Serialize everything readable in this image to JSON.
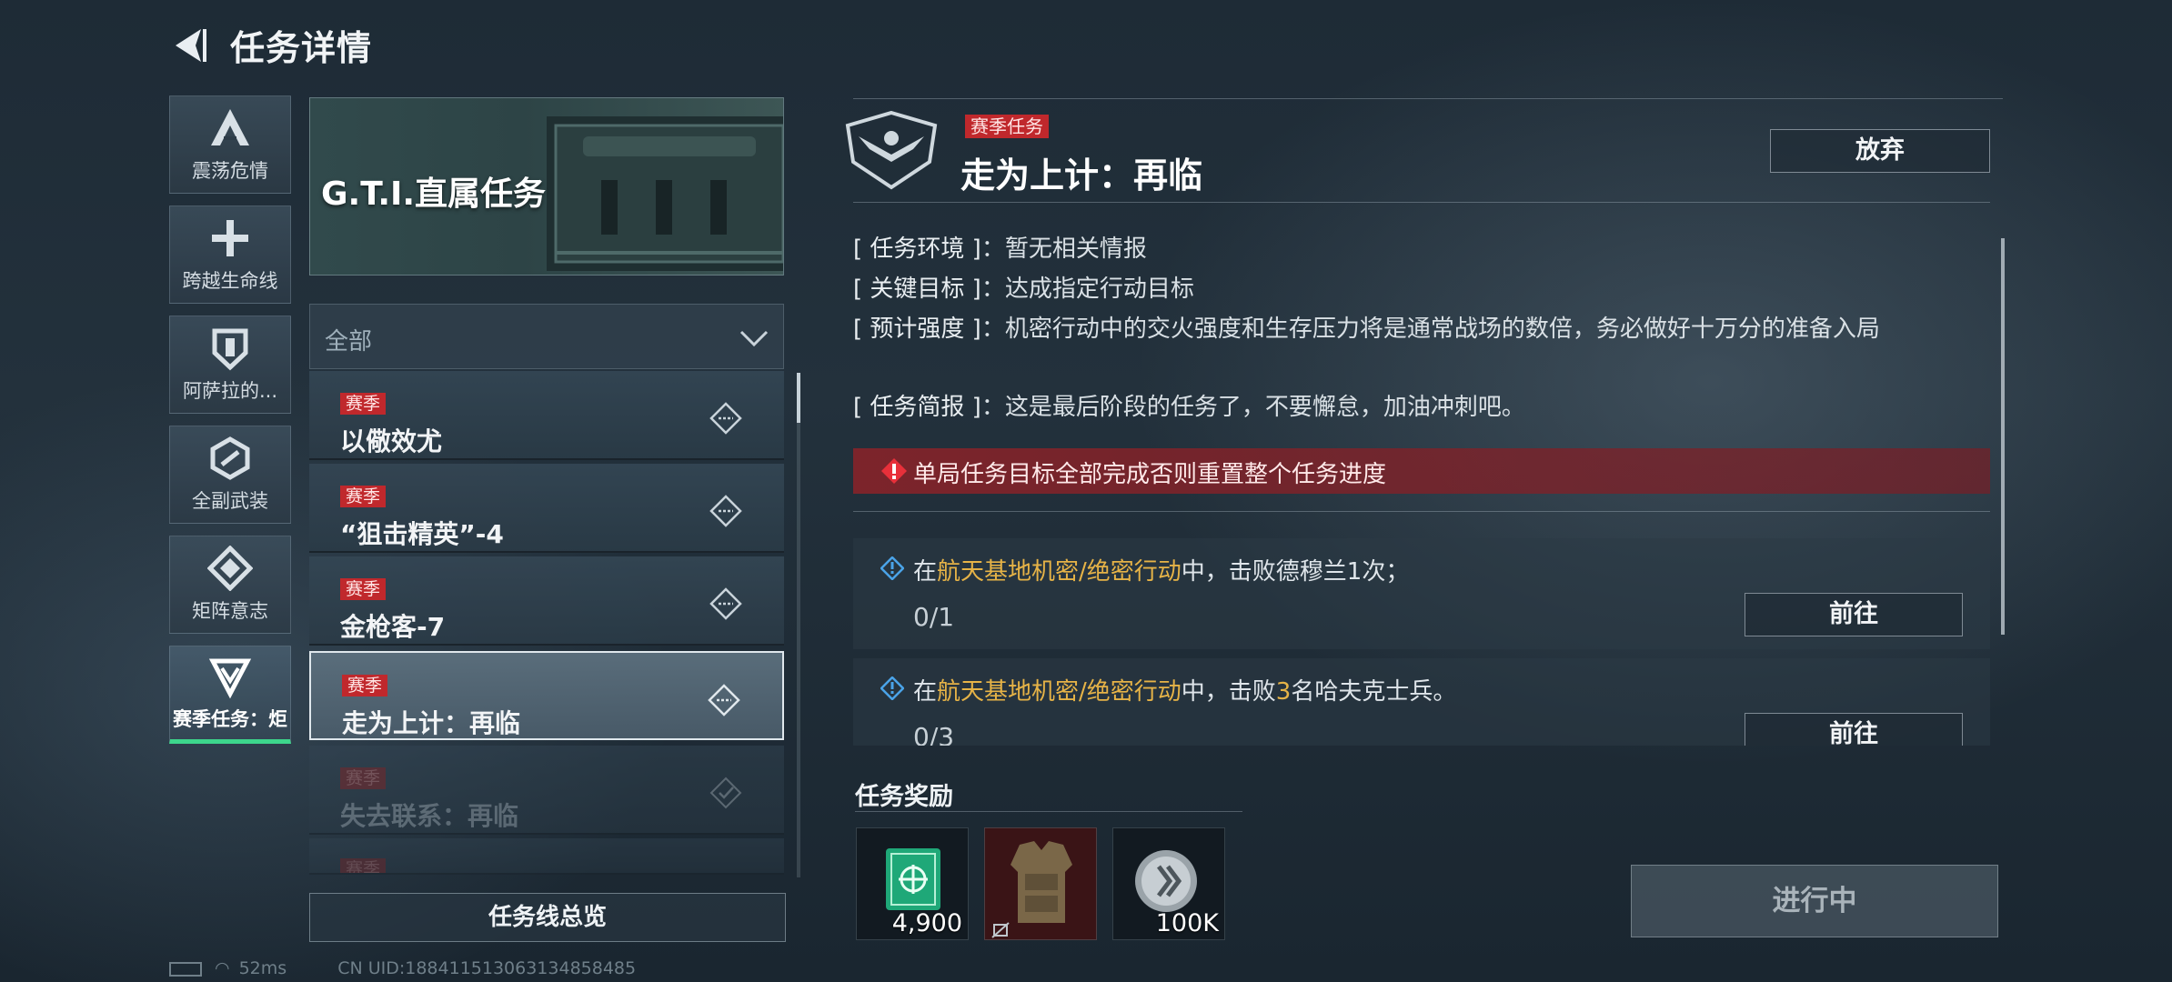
{
  "header": {
    "title": "任务详情"
  },
  "categories": [
    {
      "label": "震荡危情",
      "icon": "triangle-a-icon"
    },
    {
      "label": "跨越生命线",
      "icon": "cross-icon"
    },
    {
      "label": "阿萨拉的...",
      "icon": "shield-icon"
    },
    {
      "label": "全副武装",
      "icon": "hex-chain-icon"
    },
    {
      "label": "矩阵意志",
      "icon": "diamond-icon"
    },
    {
      "label": "赛季任务：炬",
      "icon": "chevron-triangle-icon",
      "active": true
    }
  ],
  "banner": {
    "title": "G.T.I.直属任务"
  },
  "filter": {
    "value": "全部"
  },
  "missions": [
    {
      "tag": "赛季",
      "name": "以儆效尤",
      "status": "in-progress"
    },
    {
      "tag": "赛季",
      "name": "“狙击精英”-4",
      "status": "in-progress"
    },
    {
      "tag": "赛季",
      "name": "金枪客-7",
      "status": "in-progress"
    },
    {
      "tag": "赛季",
      "name": "走为上计：再临",
      "status": "in-progress",
      "selected": true
    },
    {
      "tag": "赛季",
      "name": "失去联系：再临",
      "status": "done"
    },
    {
      "tag": "赛季",
      "name": "",
      "status": "done"
    }
  ],
  "overview_button": "任务线总览",
  "detail": {
    "tag": "赛季任务",
    "title": "走为上计：再临",
    "abandon_label": "放弃",
    "info": [
      {
        "key": "[ 任务环境 ]",
        "value": "暂无相关情报"
      },
      {
        "key": "[ 关键目标 ]",
        "value": "达成指定行动目标"
      },
      {
        "key": "[ 预计强度 ]",
        "value": "机密行动中的交火强度和生存压力将是通常战场的数倍，务必做好十万分的准备入局"
      },
      {
        "key": "[ 任务简报 ]",
        "value": "这是最后阶段的任务了，不要懈怠，加油冲刺吧。"
      }
    ],
    "warning": "单局任务目标全部完成否则重置整个任务进度",
    "objectives": [
      {
        "pre": "在",
        "highlight": "航天基地机密/绝密行动",
        "mid": "中，击败德穆兰1次；",
        "num": "",
        "post": "",
        "progress": "0/1",
        "button": "前往"
      },
      {
        "pre": "在",
        "highlight": "航天基地机密/绝密行动",
        "mid": "中，击败",
        "num": "3",
        "post": "名哈夫克士兵。",
        "progress": "0/3",
        "button": "前往"
      }
    ]
  },
  "rewards": {
    "title": "任务奖励",
    "items": [
      {
        "icon": "token-card-icon",
        "quantity": "4,900"
      },
      {
        "icon": "body-armor-icon",
        "quantity": ""
      },
      {
        "icon": "silver-coin-icon",
        "quantity": "100K"
      }
    ]
  },
  "status_button": "进行中",
  "statusbar": {
    "ping": "52ms",
    "uid": "CN UID:188411513063134858485"
  },
  "colors": {
    "season_red": "#c0282c",
    "highlight": "#e6b347",
    "active_green": "#3dd68c"
  }
}
